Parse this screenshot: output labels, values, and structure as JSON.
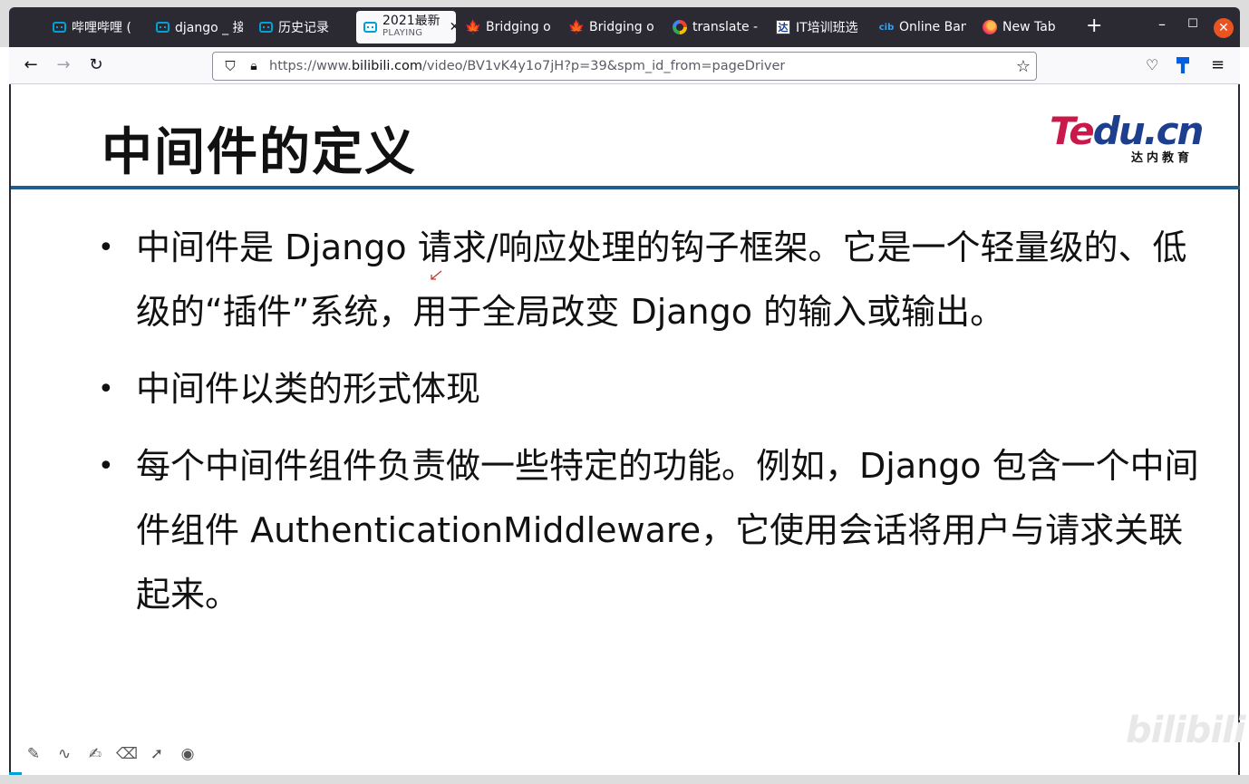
{
  "tabs": [
    {
      "label": "哔哩哔哩 (",
      "icon": "bilibili-icon"
    },
    {
      "label": "django _ 接",
      "icon": "bilibili-icon"
    },
    {
      "label": "历史记录",
      "icon": "bilibili-icon"
    },
    {
      "label": "2021最新",
      "sublabel": "PLAYING",
      "icon": "bilibili-icon",
      "active": true
    },
    {
      "label": "Bridging o",
      "icon": "maple-leaf-icon"
    },
    {
      "label": "Bridging o",
      "icon": "maple-leaf-icon"
    },
    {
      "label": "translate -",
      "icon": "google-icon"
    },
    {
      "label": "IT培训班选",
      "icon": "it-site-icon"
    },
    {
      "label": "Online Ban",
      "icon": "cibc-icon"
    },
    {
      "label": "New Tab",
      "icon": "firefox-icon"
    }
  ],
  "url": {
    "scheme": "https://www.",
    "host": "bilibili.com",
    "path": "/video/BV1vK4y1o7jH?p=39&spm_id_from=pageDriver"
  },
  "slide": {
    "title": "中间件的定义",
    "logo_text_left": "Te",
    "logo_text_right": "du.cn",
    "logo_sub": "达内教育",
    "bullets": [
      "中间件是 Django 请求/响应处理的钩子框架。它是一个轻量级的、低级的“插件”系统，用于全局改变 Django 的输入或输出。",
      "中间件以类的形式体现",
      "每个中间件组件负责做一些特定的功能。例如，Django 包含一个中间件组件 AuthenticationMiddleware，它使用会话将用户与请求关联起来。"
    ],
    "bullet_symbol": "•"
  },
  "watermark": "bilibili",
  "colors": {
    "title_rule": "#1f5f8f",
    "logo_red": "#c8194a",
    "logo_blue": "#1d3f8e",
    "tabbar": "#2b2a33",
    "bilibili_blue": "#00a1d6"
  }
}
